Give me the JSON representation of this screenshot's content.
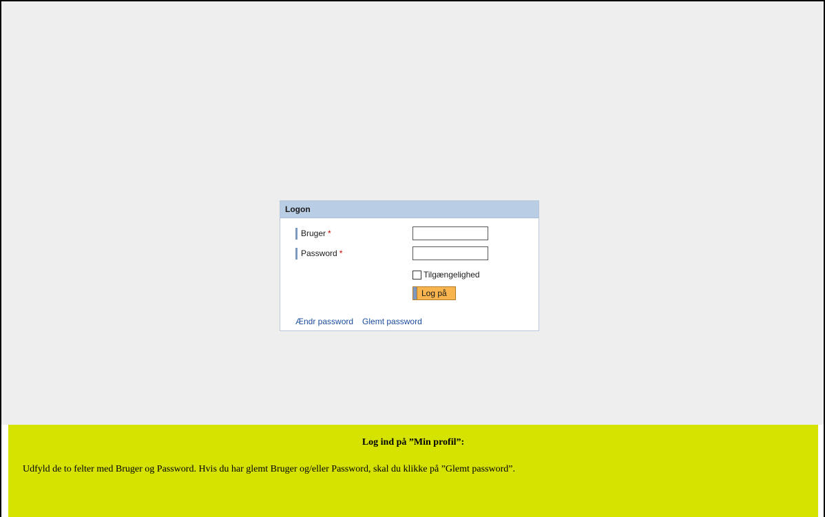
{
  "logon": {
    "title": "Logon",
    "fields": {
      "user": {
        "label": "Bruger",
        "required_mark": "*",
        "value": ""
      },
      "password": {
        "label": "Password",
        "required_mark": "*",
        "value": ""
      }
    },
    "accessibility_label": "Tilgængelighed",
    "accessibility_checked": false,
    "login_button": "Log på",
    "links": {
      "change_password": "Ændr password",
      "forgot_password": "Glemt password"
    }
  },
  "instruction": {
    "title": "Log ind på ”Min profil”:",
    "text": "Udfyld de to felter med Bruger og Password. Hvis du har glemt Bruger og/eller Password, skal du klikke på  ”Glemt password”."
  },
  "colors": {
    "background": "#eeeeee",
    "header": "#b9cde4",
    "button": "#f8b44e",
    "instruction_bg": "#d6e300",
    "link": "#1a4b9b"
  }
}
